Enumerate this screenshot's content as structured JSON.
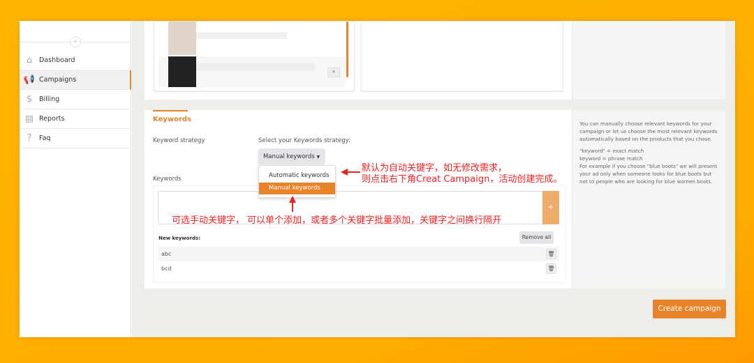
{
  "sidebar": {
    "items": [
      {
        "label": "Dashboard",
        "icon": "home-icon"
      },
      {
        "label": "Campaigns",
        "icon": "megaphone-icon",
        "active": true
      },
      {
        "label": "Billing",
        "icon": "dollar-icon"
      },
      {
        "label": "Reports",
        "icon": "document-icon"
      },
      {
        "label": "Faq",
        "icon": "question-icon"
      }
    ]
  },
  "keywords": {
    "title": "Keywords",
    "strategy_label": "Keyword strategy",
    "select_label": "Select your Keywords strategy:",
    "selected": "Manual keywords",
    "options": [
      "Automatic keywords",
      "Manual keywords"
    ],
    "keywords_label": "Keywords",
    "add_button": "+",
    "new_keywords_label": "New keywords:",
    "remove_all": "Remove all",
    "list": [
      "abc",
      "bcd"
    ]
  },
  "help": {
    "p1": "You can manually choose relevant keywords for your campaign or let us choose the most relevant keywords automatically based on the products that you chose.",
    "l1": "\"keyword\" = exact match",
    "l2": "keyword = phrase match",
    "l3": "For example if you choose \"blue boots\" we will present your ad only when someone looks for blue boots but not to people who are looking for blue women boots."
  },
  "annotations": {
    "a1_line1": "默认为自动关键字，如无修改需求，",
    "a1_line2": "则点击右下角Creat Campaign，活动创建完成。",
    "a2": "可选手动关键字， 可以单个添加，或者多个关键字批量添加，关键字之间换行隔开"
  },
  "create_button": "Create campaign",
  "colors": {
    "accent": "#e8832a",
    "annotation": "#f02020"
  }
}
